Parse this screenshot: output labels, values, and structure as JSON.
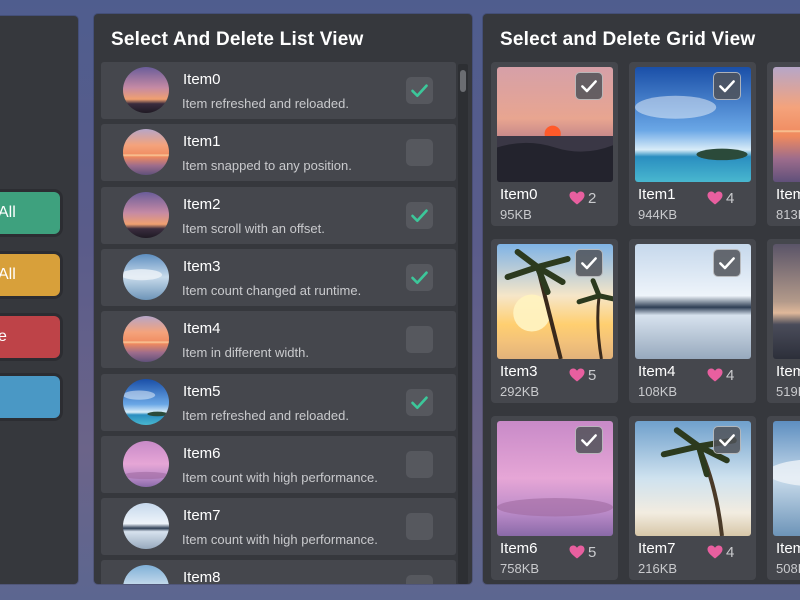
{
  "colors": {
    "accent_check": "#3cc79a",
    "heart": "#e85f9f",
    "btn_green": "#3ea17e",
    "btn_orange": "#d8a03a",
    "btn_red": "#be4348",
    "btn_blue": "#4a98c5"
  },
  "side_buttons": [
    {
      "label": "All",
      "color": "#3ea17e"
    },
    {
      "label": "All",
      "color": "#d8a03a"
    },
    {
      "label": "e",
      "color": "#be4348"
    },
    {
      "label": "",
      "color": "#4a98c5"
    }
  ],
  "list_view": {
    "title": "Select And Delete List View",
    "items": [
      {
        "name": "Item0",
        "desc": "Item refreshed and reloaded.",
        "checked": true,
        "thumb": "sunset-purple"
      },
      {
        "name": "Item1",
        "desc": "Item snapped to any position.",
        "checked": false,
        "thumb": "sunset-orange"
      },
      {
        "name": "Item2",
        "desc": "Item scroll with an offset.",
        "checked": true,
        "thumb": "sunset-purple"
      },
      {
        "name": "Item3",
        "desc": "Item count changed at runtime.",
        "checked": true,
        "thumb": "cloud-blue"
      },
      {
        "name": "Item4",
        "desc": "Item in different width.",
        "checked": false,
        "thumb": "sunset-orange"
      },
      {
        "name": "Item5",
        "desc": "Item refreshed and reloaded.",
        "checked": true,
        "thumb": "sky-island"
      },
      {
        "name": "Item6",
        "desc": "Item count with high performance.",
        "checked": false,
        "thumb": "pink-clouds"
      },
      {
        "name": "Item7",
        "desc": "Item count with high performance.",
        "checked": false,
        "thumb": "snow-lake"
      },
      {
        "name": "Item8",
        "desc": "",
        "checked": false,
        "thumb": "palm"
      }
    ]
  },
  "grid_view": {
    "title": "Select and Delete Grid View",
    "items": [
      {
        "name": "Item0",
        "size": "95KB",
        "likes": "2",
        "checked": true,
        "img": "sunset-lake"
      },
      {
        "name": "Item1",
        "size": "944KB",
        "likes": "4",
        "checked": true,
        "img": "sky-island"
      },
      {
        "name": "Item",
        "size": "813K",
        "likes": "",
        "checked": false,
        "img": "sunset-orange"
      },
      {
        "name": "Item3",
        "size": "292KB",
        "likes": "5",
        "checked": true,
        "img": "palm-sun"
      },
      {
        "name": "Item4",
        "size": "108KB",
        "likes": "4",
        "checked": true,
        "img": "snow-lake"
      },
      {
        "name": "Item",
        "size": "519K",
        "likes": "",
        "checked": false,
        "img": "dusk-sea"
      },
      {
        "name": "Item6",
        "size": "758KB",
        "likes": "5",
        "checked": true,
        "img": "pink-clouds"
      },
      {
        "name": "Item7",
        "size": "216KB",
        "likes": "4",
        "checked": true,
        "img": "palm-sky"
      },
      {
        "name": "Item",
        "size": "508K",
        "likes": "",
        "checked": false,
        "img": "cloud-blue"
      }
    ]
  }
}
